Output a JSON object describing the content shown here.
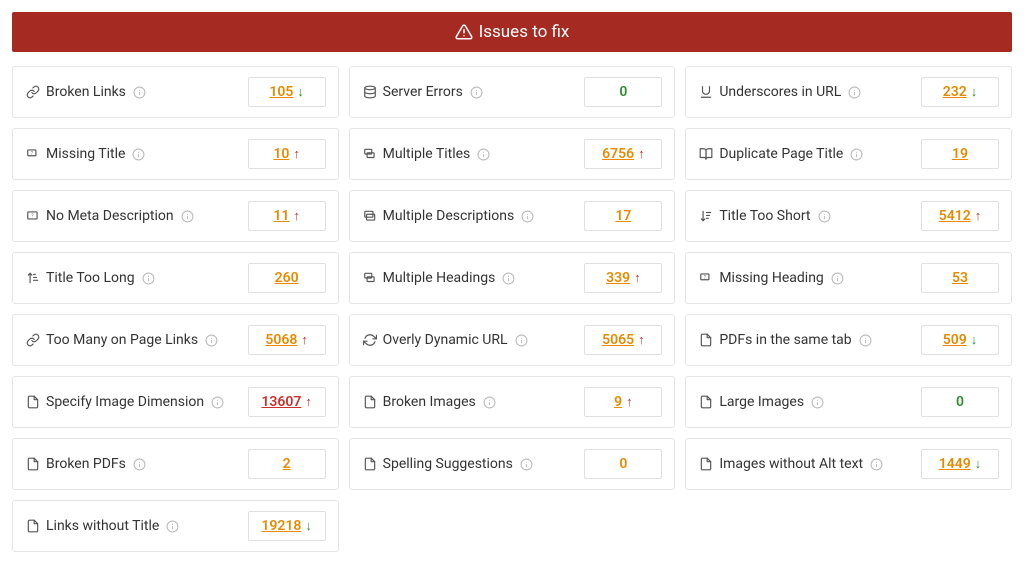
{
  "header": {
    "title": "Issues to fix"
  },
  "issues": [
    {
      "id": "broken-links",
      "icon": "link-broken",
      "label": "Broken Links",
      "value": 105,
      "color": "orange",
      "trend": "down"
    },
    {
      "id": "server-errors",
      "icon": "database",
      "label": "Server Errors",
      "value": 0,
      "color": "green",
      "trend": null
    },
    {
      "id": "underscores-url",
      "icon": "underline",
      "label": "Underscores in URL",
      "value": 232,
      "color": "orange",
      "trend": "down"
    },
    {
      "id": "missing-title",
      "icon": "tag-q",
      "label": "Missing Title",
      "value": 10,
      "color": "orange",
      "trend": "up"
    },
    {
      "id": "multiple-titles",
      "icon": "tags",
      "label": "Multiple Titles",
      "value": 6756,
      "color": "orange",
      "trend": "up"
    },
    {
      "id": "duplicate-title",
      "icon": "book",
      "label": "Duplicate Page Title",
      "value": 19,
      "color": "orange",
      "trend": null
    },
    {
      "id": "no-meta-desc",
      "icon": "card-q",
      "label": "No Meta Description",
      "value": 11,
      "color": "orange",
      "trend": "up"
    },
    {
      "id": "multiple-desc",
      "icon": "cards",
      "label": "Multiple Descriptions",
      "value": 17,
      "color": "orange",
      "trend": null
    },
    {
      "id": "title-too-short",
      "icon": "sort-short",
      "label": "Title Too Short",
      "value": 5412,
      "color": "orange",
      "trend": "up"
    },
    {
      "id": "title-too-long",
      "icon": "sort-long",
      "label": "Title Too Long",
      "value": 260,
      "color": "orange",
      "trend": null
    },
    {
      "id": "multiple-headings",
      "icon": "tags",
      "label": "Multiple Headings",
      "value": 339,
      "color": "orange",
      "trend": "up"
    },
    {
      "id": "missing-heading",
      "icon": "tag-q",
      "label": "Missing Heading",
      "value": 53,
      "color": "orange",
      "trend": null
    },
    {
      "id": "too-many-links",
      "icon": "link",
      "label": "Too Many on Page Links",
      "value": 5068,
      "color": "orange",
      "trend": "up"
    },
    {
      "id": "dynamic-url",
      "icon": "refresh",
      "label": "Overly Dynamic URL",
      "value": 5065,
      "color": "orange",
      "trend": "up"
    },
    {
      "id": "pdfs-same-tab",
      "icon": "file",
      "label": "PDFs in the same tab",
      "value": 509,
      "color": "orange",
      "trend": "down"
    },
    {
      "id": "image-dimension",
      "icon": "file",
      "label": "Specify Image Dimension",
      "value": 13607,
      "color": "red",
      "trend": "up"
    },
    {
      "id": "broken-images",
      "icon": "file",
      "label": "Broken Images",
      "value": 9,
      "color": "orange",
      "trend": "up"
    },
    {
      "id": "large-images",
      "icon": "file",
      "label": "Large Images",
      "value": 0,
      "color": "green",
      "trend": null
    },
    {
      "id": "broken-pdfs",
      "icon": "file",
      "label": "Broken PDFs",
      "value": 2,
      "color": "orange",
      "trend": null
    },
    {
      "id": "spelling",
      "icon": "file",
      "label": "Spelling Suggestions",
      "value": 0,
      "color": "orange",
      "trend": null
    },
    {
      "id": "images-no-alt",
      "icon": "file",
      "label": "Images without Alt text",
      "value": 1449,
      "color": "orange",
      "trend": "down"
    },
    {
      "id": "links-no-title",
      "icon": "file",
      "label": "Links without Title",
      "value": 19218,
      "color": "orange",
      "trend": "down"
    }
  ]
}
